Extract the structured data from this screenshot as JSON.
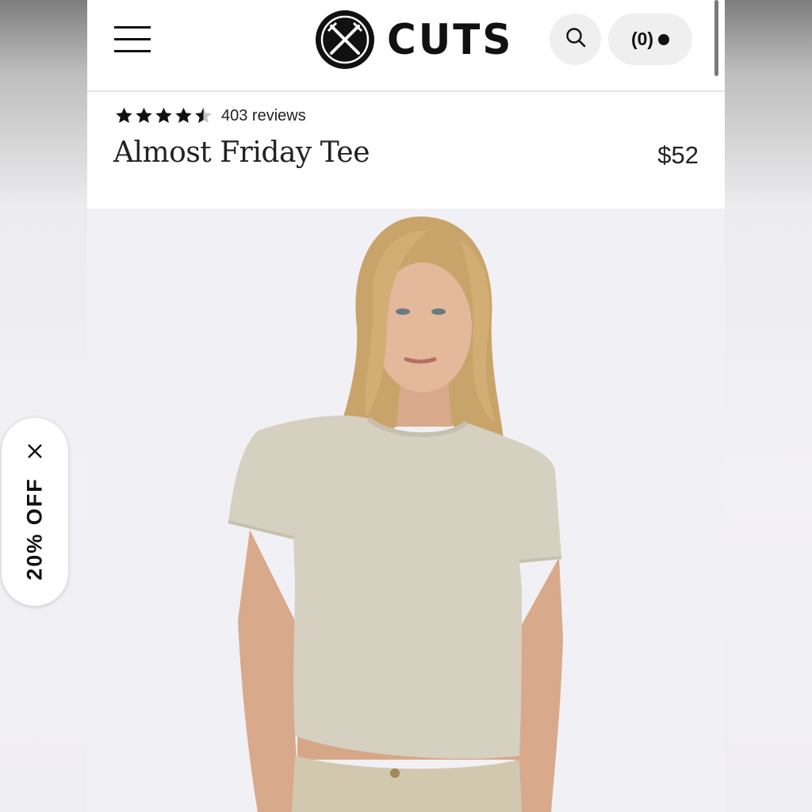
{
  "header": {
    "brand_name": "CUTS",
    "cart_label": "(0)",
    "icons": {
      "menu": "hamburger-menu-icon",
      "search": "search-icon",
      "cart_indicator": "dot-icon",
      "logo": "crossed-swords-logo-icon"
    }
  },
  "product": {
    "rating": 4.5,
    "reviews_label": "403 reviews",
    "title": "Almost Friday Tee",
    "price": "$52"
  },
  "promo": {
    "label": "20% OFF",
    "close_icon": "close-icon"
  },
  "colors": {
    "text": "#111111",
    "button_bg": "#efefef",
    "image_bg": "#f1f0f5",
    "tee": "#d6d0c0"
  }
}
